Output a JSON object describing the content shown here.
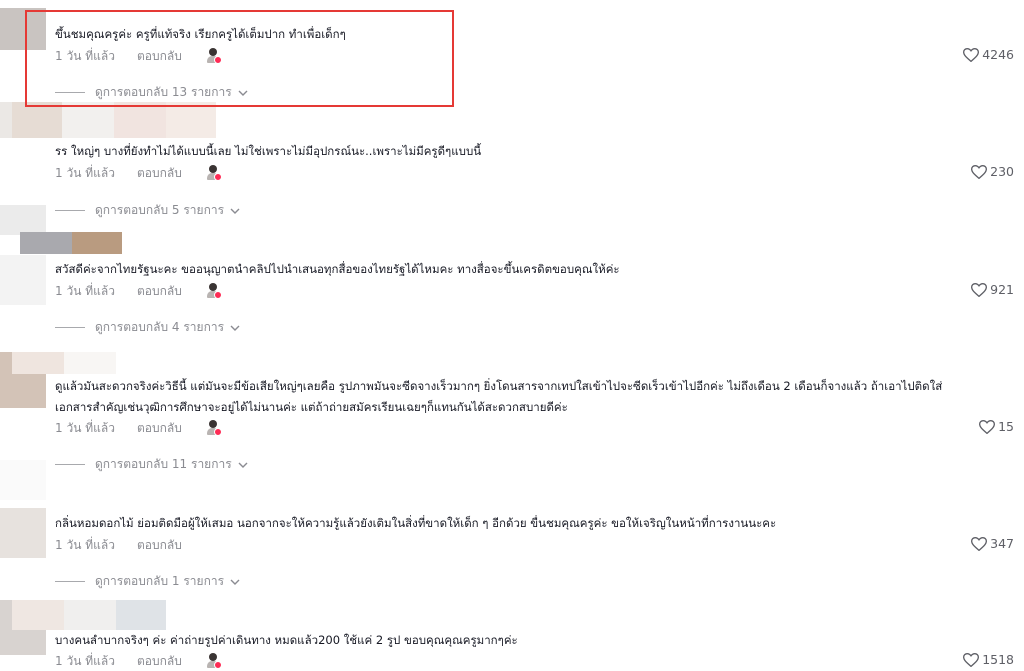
{
  "comments": [
    {
      "text": "ขึ้นชมคุณครูค่ะ ครูที่แท้จริง เรียกครูได้เต็มปาก ทำเพื่อเด็กๆ",
      "time": "1 วัน ที่แล้ว",
      "reply_label": "ตอบกลับ",
      "likes": "4246",
      "view_replies": "ดูการตอบกลับ 13 รายการ"
    },
    {
      "text": "รร ใหญ่ๆ บางที่ยังทำไม่ได้แบบนี้เลย ไม่ใช่เพราะไม่มีอุปกรณ์นะ..เพราะไม่มีครูดีๆแบบนี้",
      "time": "1 วัน ที่แล้ว",
      "reply_label": "ตอบกลับ",
      "likes": "230",
      "view_replies": "ดูการตอบกลับ 5 รายการ"
    },
    {
      "text": "สวัสดีค่ะจากไทยรัฐนะคะ ขออนุญาตนำคลิปไปนำเสนอทุกสื่อของไทยรัฐได้ไหมคะ ทางสื่อจะขึ้นเครดิตขอบคุณให้ค่ะ",
      "time": "1 วัน ที่แล้ว",
      "reply_label": "ตอบกลับ",
      "likes": "921",
      "view_replies": "ดูการตอบกลับ 4 รายการ"
    },
    {
      "text_line1": "ดูแล้วมันสะดวกจริงค่ะวิธีนี้ แต่มันจะมีข้อเสียใหญ่ๆเลยคือ รูปภาพมันจะซีดจางเร็วมากๆ ยิ่งโดนสารจากเทปใสเข้าไปจะซีดเร็วเข้าไปอีกค่ะ ไม่ถึงเดือน 2 เดือนก็จางแล้ว ถ้าเอาไปติดใส่",
      "text_line2": "เอกสารสำคัญเช่นวุฒิการศึกษาจะอยู่ได้ไม่นานค่ะ แต่ถ้าถ่ายสมัครเรียนเฉยๆก็แทนกันได้สะดวกสบายดีค่ะ",
      "time": "1 วัน ที่แล้ว",
      "reply_label": "ตอบกลับ",
      "likes": "15",
      "view_replies": "ดูการตอบกลับ 11 รายการ"
    },
    {
      "text": "กลิ่นหอมดอกไม้ ย่อมติดมือผู้ให้เสมอ นอกจากจะให้ความรู้แล้วยังเติมในสิ่งที่ขาดให้เด็ก ๆ อีกด้วย ขื่นชมคุณครูค่ะ ขอให้เจริญในหน้าที่การงานนะคะ",
      "time": "1 วัน ที่แล้ว",
      "reply_label": "ตอบกลับ",
      "likes": "347",
      "view_replies": "ดูการตอบกลับ 1 รายการ"
    },
    {
      "text": "บางคนลำบากจริงๆ ค่ะ ค่าถ่ายรูปค่าเดินทาง หมดแล้ว200 ใช้แค่ 2 รูป ขอบคุณคุณครูมากๆค่ะ",
      "time": "1 วัน ที่แล้ว",
      "reply_label": "ตอบกลับ",
      "likes": "1518"
    }
  ]
}
